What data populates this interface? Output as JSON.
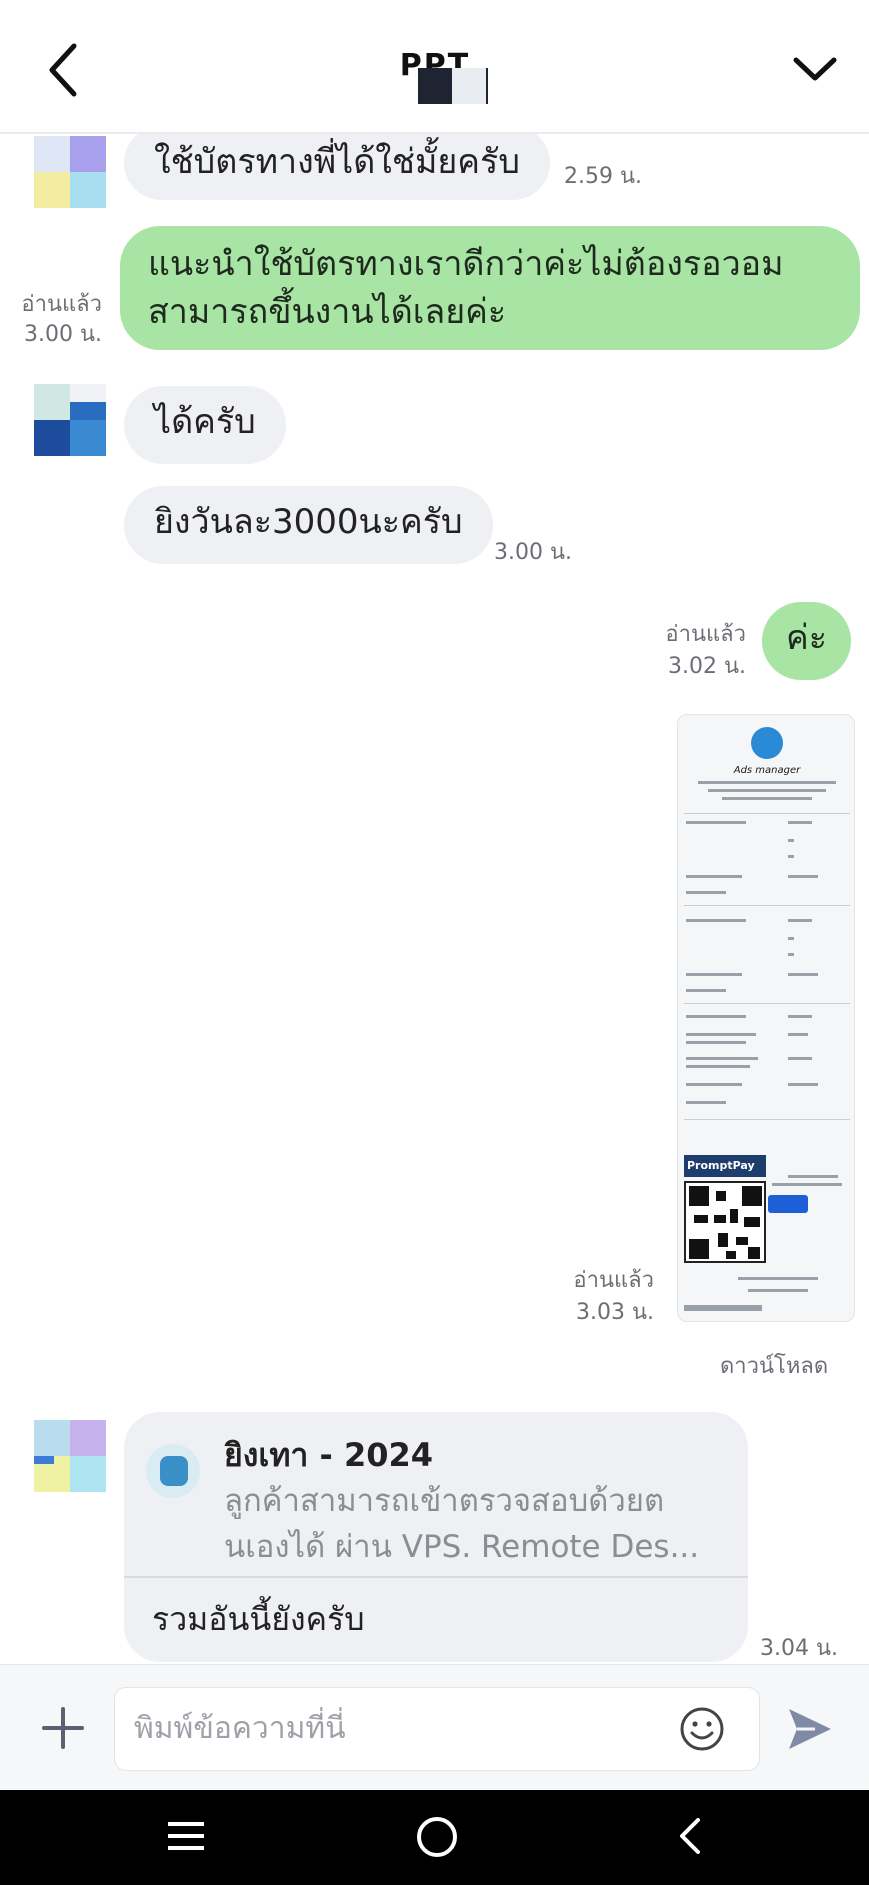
{
  "header": {
    "title": "PPT"
  },
  "messages": [
    {
      "text": "ใช้บัตรทางพี่ได้ใช่มั้ยครับ",
      "time": "2.59 น."
    },
    {
      "line1": "แนะนำใช้บัตรทางเราดีกว่าค่ะไม่ต้องรอวอม",
      "line2": "สามารถขึ้นงานได้เลยค่ะ",
      "read": "อ่านแล้ว",
      "time": "3.00 น."
    },
    {
      "text": "ได้ครับ"
    },
    {
      "text": "ยิงวันละ3000นะครับ",
      "time": "3.00 น."
    },
    {
      "text": "ค่ะ",
      "read": "อ่านแล้ว",
      "time": "3.02 น."
    },
    {
      "read": "อ่านแล้ว",
      "time": "3.03 น.",
      "download": "ดาวน์โหลด"
    }
  ],
  "receipt": {
    "title": "Ads manager",
    "promptpay": "PromptPay"
  },
  "shared_card": {
    "title": "ยิงเทา - 2024",
    "desc_line1": "ลูกค้าสามารถเข้าตรวจสอบด้วยต",
    "desc_line2": "นเองได้ ผ่าน VPS. Remote Des...",
    "message": "รวมอันนี้ยังครับ",
    "time": "3.04 น."
  },
  "input": {
    "placeholder": "พิมพ์ข้อความที่นี่"
  },
  "icons": [
    "back-chevron-icon",
    "dropdown-chevron-icon",
    "plus-icon",
    "emoji-icon",
    "send-icon",
    "recents-icon",
    "home-icon",
    "back-icon"
  ],
  "colors": {
    "outgoing_bubble": "#a8e4a4",
    "incoming_bubble": "#eef0f3",
    "send_icon": "#8a96b0"
  }
}
